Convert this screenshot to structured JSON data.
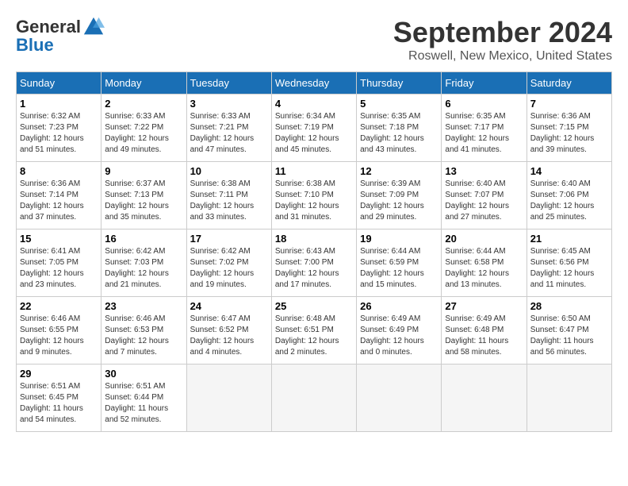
{
  "header": {
    "logo_general": "General",
    "logo_blue": "Blue",
    "month_title": "September 2024",
    "location": "Roswell, New Mexico, United States"
  },
  "weekdays": [
    "Sunday",
    "Monday",
    "Tuesday",
    "Wednesday",
    "Thursday",
    "Friday",
    "Saturday"
  ],
  "weeks": [
    [
      {
        "day": "1",
        "sunrise": "6:32 AM",
        "sunset": "7:23 PM",
        "daylight": "12 hours and 51 minutes."
      },
      {
        "day": "2",
        "sunrise": "6:33 AM",
        "sunset": "7:22 PM",
        "daylight": "12 hours and 49 minutes."
      },
      {
        "day": "3",
        "sunrise": "6:33 AM",
        "sunset": "7:21 PM",
        "daylight": "12 hours and 47 minutes."
      },
      {
        "day": "4",
        "sunrise": "6:34 AM",
        "sunset": "7:19 PM",
        "daylight": "12 hours and 45 minutes."
      },
      {
        "day": "5",
        "sunrise": "6:35 AM",
        "sunset": "7:18 PM",
        "daylight": "12 hours and 43 minutes."
      },
      {
        "day": "6",
        "sunrise": "6:35 AM",
        "sunset": "7:17 PM",
        "daylight": "12 hours and 41 minutes."
      },
      {
        "day": "7",
        "sunrise": "6:36 AM",
        "sunset": "7:15 PM",
        "daylight": "12 hours and 39 minutes."
      }
    ],
    [
      {
        "day": "8",
        "sunrise": "6:36 AM",
        "sunset": "7:14 PM",
        "daylight": "12 hours and 37 minutes."
      },
      {
        "day": "9",
        "sunrise": "6:37 AM",
        "sunset": "7:13 PM",
        "daylight": "12 hours and 35 minutes."
      },
      {
        "day": "10",
        "sunrise": "6:38 AM",
        "sunset": "7:11 PM",
        "daylight": "12 hours and 33 minutes."
      },
      {
        "day": "11",
        "sunrise": "6:38 AM",
        "sunset": "7:10 PM",
        "daylight": "12 hours and 31 minutes."
      },
      {
        "day": "12",
        "sunrise": "6:39 AM",
        "sunset": "7:09 PM",
        "daylight": "12 hours and 29 minutes."
      },
      {
        "day": "13",
        "sunrise": "6:40 AM",
        "sunset": "7:07 PM",
        "daylight": "12 hours and 27 minutes."
      },
      {
        "day": "14",
        "sunrise": "6:40 AM",
        "sunset": "7:06 PM",
        "daylight": "12 hours and 25 minutes."
      }
    ],
    [
      {
        "day": "15",
        "sunrise": "6:41 AM",
        "sunset": "7:05 PM",
        "daylight": "12 hours and 23 minutes."
      },
      {
        "day": "16",
        "sunrise": "6:42 AM",
        "sunset": "7:03 PM",
        "daylight": "12 hours and 21 minutes."
      },
      {
        "day": "17",
        "sunrise": "6:42 AM",
        "sunset": "7:02 PM",
        "daylight": "12 hours and 19 minutes."
      },
      {
        "day": "18",
        "sunrise": "6:43 AM",
        "sunset": "7:00 PM",
        "daylight": "12 hours and 17 minutes."
      },
      {
        "day": "19",
        "sunrise": "6:44 AM",
        "sunset": "6:59 PM",
        "daylight": "12 hours and 15 minutes."
      },
      {
        "day": "20",
        "sunrise": "6:44 AM",
        "sunset": "6:58 PM",
        "daylight": "12 hours and 13 minutes."
      },
      {
        "day": "21",
        "sunrise": "6:45 AM",
        "sunset": "6:56 PM",
        "daylight": "12 hours and 11 minutes."
      }
    ],
    [
      {
        "day": "22",
        "sunrise": "6:46 AM",
        "sunset": "6:55 PM",
        "daylight": "12 hours and 9 minutes."
      },
      {
        "day": "23",
        "sunrise": "6:46 AM",
        "sunset": "6:53 PM",
        "daylight": "12 hours and 7 minutes."
      },
      {
        "day": "24",
        "sunrise": "6:47 AM",
        "sunset": "6:52 PM",
        "daylight": "12 hours and 4 minutes."
      },
      {
        "day": "25",
        "sunrise": "6:48 AM",
        "sunset": "6:51 PM",
        "daylight": "12 hours and 2 minutes."
      },
      {
        "day": "26",
        "sunrise": "6:49 AM",
        "sunset": "6:49 PM",
        "daylight": "12 hours and 0 minutes."
      },
      {
        "day": "27",
        "sunrise": "6:49 AM",
        "sunset": "6:48 PM",
        "daylight": "11 hours and 58 minutes."
      },
      {
        "day": "28",
        "sunrise": "6:50 AM",
        "sunset": "6:47 PM",
        "daylight": "11 hours and 56 minutes."
      }
    ],
    [
      {
        "day": "29",
        "sunrise": "6:51 AM",
        "sunset": "6:45 PM",
        "daylight": "11 hours and 54 minutes."
      },
      {
        "day": "30",
        "sunrise": "6:51 AM",
        "sunset": "6:44 PM",
        "daylight": "11 hours and 52 minutes."
      },
      null,
      null,
      null,
      null,
      null
    ]
  ]
}
